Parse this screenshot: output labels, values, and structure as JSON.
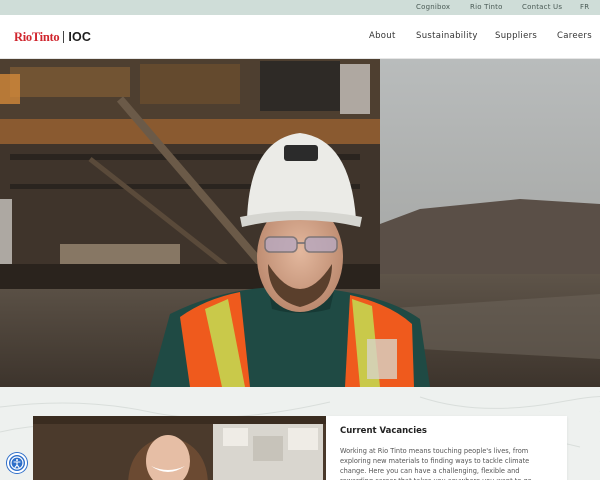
{
  "utility_nav": {
    "items": [
      "Cognibox",
      "Rio Tinto",
      "Contact Us",
      "FR"
    ]
  },
  "logo": {
    "brand": "RioTinto",
    "division": "IOC"
  },
  "main_nav": {
    "items": [
      "About",
      "Sustainability",
      "Suppliers",
      "Careers"
    ]
  },
  "vacancies": {
    "title": "Current Vacancies",
    "body": "Working at Rio Tinto means touching people's lives, from exploring new materials to finding ways to tackle climate change. Here you can have a challenging, flexible and rewarding career that takes you anywhere you want to go."
  },
  "icons": [
    "accessibility-icon"
  ]
}
